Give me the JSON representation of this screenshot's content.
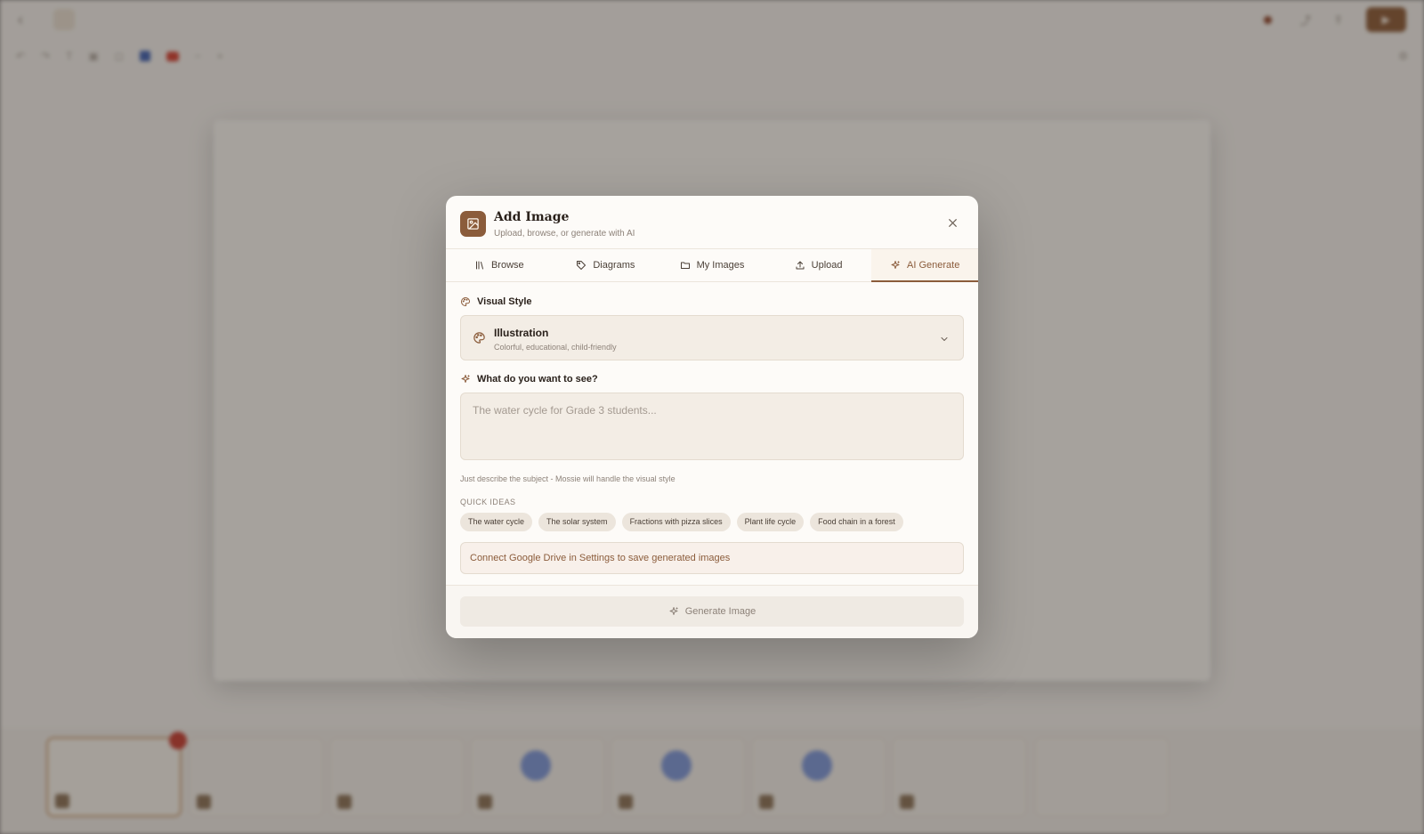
{
  "modal": {
    "title": "Add Image",
    "subtitle": "Upload, browse, or generate with AI",
    "header_icon": "image-icon",
    "close_icon": "close-icon"
  },
  "tabs": [
    {
      "label": "Browse",
      "icon": "library-icon",
      "active": false
    },
    {
      "label": "Diagrams",
      "icon": "tag-icon",
      "active": false
    },
    {
      "label": "My Images",
      "icon": "folder-icon",
      "active": false
    },
    {
      "label": "Upload",
      "icon": "upload-icon",
      "active": false
    },
    {
      "label": "AI Generate",
      "icon": "sparkle-icon",
      "active": true
    }
  ],
  "visual_style": {
    "label": "Visual Style",
    "icon": "palette-icon",
    "selected_name": "Illustration",
    "selected_desc": "Colorful, educational, child-friendly"
  },
  "prompt": {
    "label": "What do you want to see?",
    "icon": "sparkle-icon",
    "placeholder": "The water cycle for Grade 3 students...",
    "value": "",
    "helper": "Just describe the subject - Mossie will handle the visual style"
  },
  "quick_ideas": {
    "label": "QUICK IDEAS",
    "items": [
      "The water cycle",
      "The solar system",
      "Fractions with pizza slices",
      "Plant life cycle",
      "Food chain in a forest"
    ]
  },
  "drive_note": "Connect Google Drive in Settings to save generated images",
  "footer": {
    "generate_label": "Generate Image",
    "generate_icon": "sparkle-icon"
  },
  "colors": {
    "accent": "#8b5c3b",
    "modal_bg": "#fdfbf8",
    "field_bg": "#f3ede5"
  }
}
